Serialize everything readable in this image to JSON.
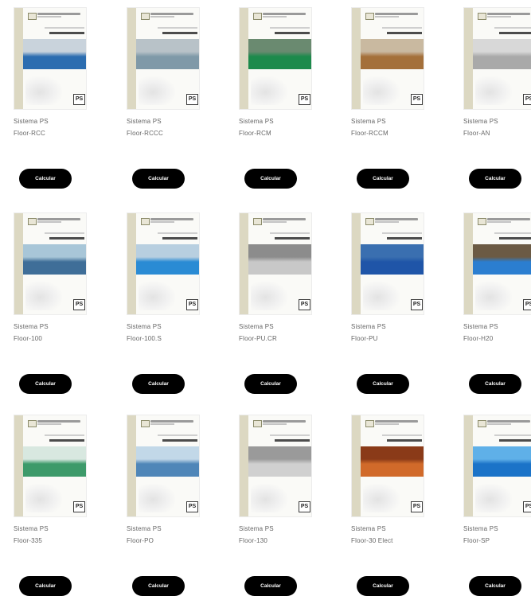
{
  "products": [
    {
      "name_line1": "Sistema PS",
      "name_line2": "Floor-RCC",
      "cover_subtitle": "PS Floor-RCC",
      "button_label": "Calcular",
      "photo_colors": [
        "#c9d3dc",
        "#2c6db0"
      ]
    },
    {
      "name_line1": "Sistema PS",
      "name_line2": "Floor-RCCC",
      "cover_subtitle": "PS Floor-RCCC",
      "button_label": "Calcular",
      "photo_colors": [
        "#b8c2c8",
        "#7f99a8"
      ]
    },
    {
      "name_line1": "Sistema PS",
      "name_line2": "Floor-RCM",
      "cover_subtitle": "PS Floor-RCM",
      "button_label": "Calcular",
      "photo_colors": [
        "#6a8a70",
        "#1d8a4c"
      ]
    },
    {
      "name_line1": "Sistema PS",
      "name_line2": "Floor-RCCM",
      "cover_subtitle": "PS Floor-RCCM",
      "button_label": "Calcular",
      "photo_colors": [
        "#c9b9a0",
        "#a4703a"
      ]
    },
    {
      "name_line1": "Sistema PS",
      "name_line2": "Floor-AN",
      "cover_subtitle": "PS Floor-AN",
      "button_label": "Calcular",
      "photo_colors": [
        "#d8d8d8",
        "#a9a9a9"
      ]
    },
    {
      "name_line1": "Sistema PS",
      "name_line2": "Floor-100",
      "cover_subtitle": "PS Floor-100",
      "button_label": "Calcular",
      "photo_colors": [
        "#a8c6d8",
        "#3f6e98"
      ]
    },
    {
      "name_line1": "Sistema PS",
      "name_line2": "Floor-100.S",
      "cover_subtitle": "PS Floor-100.S",
      "button_label": "Calcular",
      "photo_colors": [
        "#b8cfe0",
        "#2a8bd4"
      ]
    },
    {
      "name_line1": "Sistema PS",
      "name_line2": "Floor-PU.CR",
      "cover_subtitle": "PS Floor-PU.CR",
      "button_label": "Calcular",
      "photo_colors": [
        "#8c8c8c",
        "#c8c8c8"
      ]
    },
    {
      "name_line1": "Sistema PS",
      "name_line2": "Floor-PU",
      "cover_subtitle": "PS Floor-PU",
      "button_label": "Calcular",
      "photo_colors": [
        "#3a6fb0",
        "#1f55a8"
      ]
    },
    {
      "name_line1": "Sistema PS",
      "name_line2": "Floor-H20",
      "cover_subtitle": "PS Floor-H20",
      "button_label": "Calcular",
      "photo_colors": [
        "#6b5a44",
        "#2b7ed0"
      ]
    },
    {
      "name_line1": "Sistema PS",
      "name_line2": "Floor-335",
      "cover_subtitle": "PS Floor-335",
      "button_label": "Calcular",
      "photo_colors": [
        "#d8e8e0",
        "#3d9a6a"
      ]
    },
    {
      "name_line1": "Sistema PS",
      "name_line2": "Floor-PO",
      "cover_subtitle": "PS Floor-PO",
      "button_label": "Calcular",
      "photo_colors": [
        "#c2d8e8",
        "#4f86b8"
      ]
    },
    {
      "name_line1": "Sistema PS",
      "name_line2": "Floor-130",
      "cover_subtitle": "PS Floor-130",
      "button_label": "Calcular",
      "photo_colors": [
        "#9a9a9a",
        "#d0d0d0"
      ]
    },
    {
      "name_line1": "Sistema PS",
      "name_line2": "Floor-30 Elect",
      "cover_subtitle": "PS Floor-30 Elect",
      "button_label": "Calcular",
      "photo_colors": [
        "#8a3a18",
        "#d16a2a"
      ]
    },
    {
      "name_line1": "Sistema PS",
      "name_line2": "Floor-SP",
      "cover_subtitle": "PS Floor-SP",
      "button_label": "Calcular",
      "photo_colors": [
        "#5fb0e8",
        "#1b73c8"
      ]
    }
  ]
}
